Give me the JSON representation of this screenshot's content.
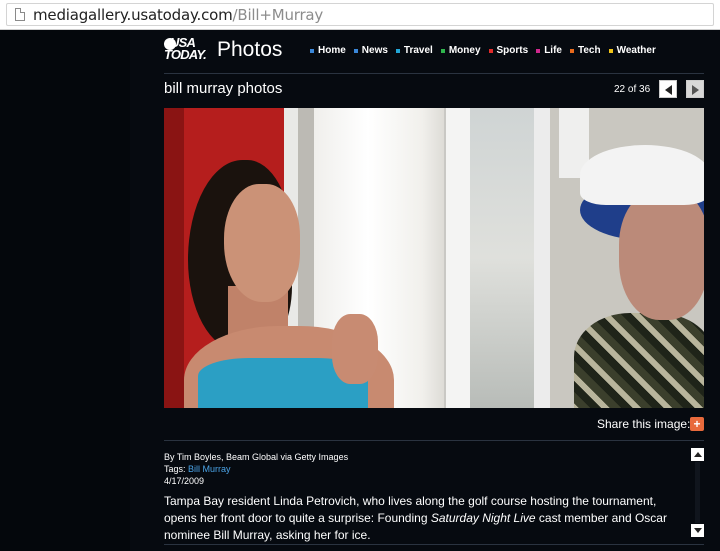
{
  "browser": {
    "url_domain": "mediagallery.usatoday.com",
    "url_path": "/Bill+Murray"
  },
  "site": {
    "logo_line1": "USA",
    "logo_line2": "TODAY.",
    "section_title": "Photos",
    "nav": [
      {
        "label": "Home",
        "color": "#3a87d9"
      },
      {
        "label": "News",
        "color": "#3a87d9"
      },
      {
        "label": "Travel",
        "color": "#22a7d8"
      },
      {
        "label": "Money",
        "color": "#2fb54c"
      },
      {
        "label": "Sports",
        "color": "#e02a2a"
      },
      {
        "label": "Life",
        "color": "#d0288d"
      },
      {
        "label": "Tech",
        "color": "#e86a1c"
      },
      {
        "label": "Weather",
        "color": "#f0c419"
      }
    ]
  },
  "gallery": {
    "title": "bill murray photos",
    "counter": "22 of 36",
    "share_label": "Share this image:",
    "share_icon": "+"
  },
  "caption": {
    "credit": "By Tim Boyles, Beam Global via Getty Images",
    "tags_label": "Tags:",
    "tag_link": "Bill Murray",
    "date": "4/17/2009",
    "desc_part1": "Tampa Bay resident Linda Petrovich, who lives along the golf course hosting the tournament, opens her front door to quite a surprise: Founding ",
    "desc_italic": "Saturday Night Live",
    "desc_part2": " cast member and Oscar nominee Bill Murray, asking her for ice."
  }
}
